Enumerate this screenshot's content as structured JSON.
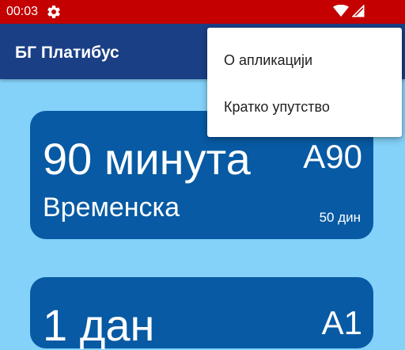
{
  "status_bar": {
    "time": "00:03",
    "background_color": "#c40000",
    "icons": [
      "settings-gear-icon",
      "wifi-icon",
      "signal-icon"
    ]
  },
  "app_bar": {
    "title": "БГ Платибус",
    "background_color": "#1a3f85"
  },
  "menu": {
    "items": [
      {
        "label": "О апликацији"
      },
      {
        "label": "Кратко упутство"
      }
    ]
  },
  "tickets": [
    {
      "duration": "90 минута",
      "code": "A90",
      "type": "Временска",
      "price": "50 дин"
    },
    {
      "duration": "1 дан",
      "code": "A1"
    }
  ],
  "colors": {
    "page_background": "#84d2fa",
    "card_background": "#075aa3",
    "menu_background": "#ffffff"
  }
}
